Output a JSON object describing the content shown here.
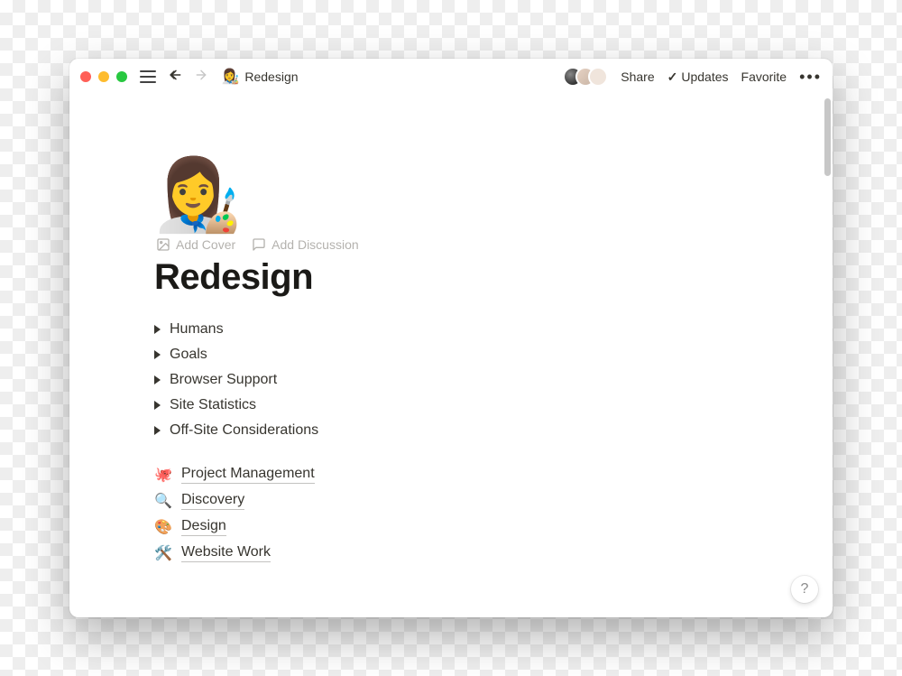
{
  "header": {
    "breadcrumb_emoji": "👩‍🎨",
    "breadcrumb_title": "Redesign",
    "share_label": "Share",
    "updates_label": "Updates",
    "favorite_label": "Favorite"
  },
  "page": {
    "icon": "👩‍🎨",
    "add_cover_label": "Add Cover",
    "add_discussion_label": "Add Discussion",
    "title": "Redesign",
    "toggles": [
      "Humans",
      "Goals",
      "Browser Support",
      "Site Statistics",
      "Off-Site Considerations"
    ],
    "links": [
      {
        "emoji": "🐙",
        "label": "Project Management"
      },
      {
        "emoji": "🔍",
        "label": "Discovery"
      },
      {
        "emoji": "🎨",
        "label": "Design"
      },
      {
        "emoji": "🛠️",
        "label": "Website Work"
      }
    ]
  },
  "help_label": "?"
}
